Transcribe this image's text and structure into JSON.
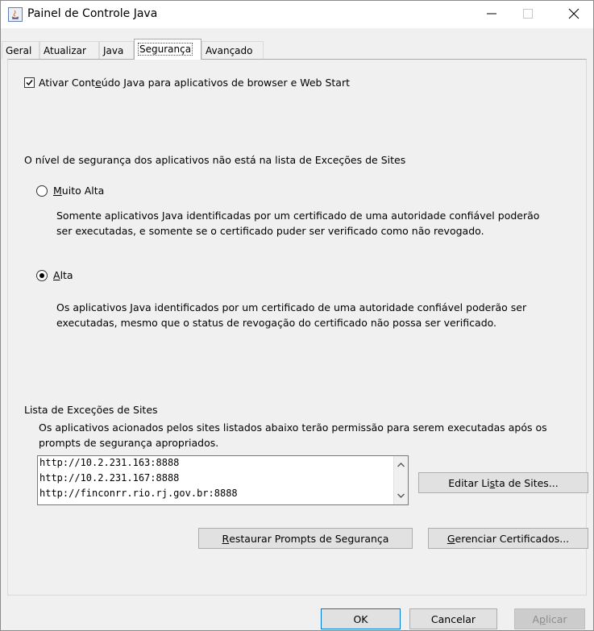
{
  "window": {
    "title": "Painel de Controle Java"
  },
  "tabs": [
    {
      "label": "Geral"
    },
    {
      "label": "Atualizar"
    },
    {
      "label": "Java"
    },
    {
      "label": "Segurança",
      "active": true
    },
    {
      "label": "Avançado"
    }
  ],
  "security": {
    "enable_java": {
      "label_pre": "Ativar Cont",
      "label_mnemonic": "e",
      "label_post": "údo Java para aplicativos de browser e Web Start",
      "checked": true
    },
    "level_heading": "O nível de segurança dos aplicativos não está na lista de Exceções de Sites",
    "levels": [
      {
        "mnemonic": "M",
        "label_rest": "uito Alta",
        "checked": false,
        "desc_line1": "Somente aplicativos Java identificadas por um certificado de uma autoridade confiável poderão",
        "desc_line2": "ser executadas, e somente se o certificado puder ser verificado como não revogado."
      },
      {
        "mnemonic": "A",
        "label_rest": "lta",
        "checked": true,
        "desc_line1": "Os aplicativos Java identificados por um certificado de uma autoridade confiável poderão ser",
        "desc_line2": "executadas, mesmo que o status de revogação do certificado não possa ser verificado."
      }
    ],
    "exceptions": {
      "heading": "Lista de Exceções de Sites",
      "desc_line1": "Os aplicativos acionados pelos sites listados abaixo terão permissão para serem executadas após os",
      "desc_line2": "prompts de segurança apropriados.",
      "sites": [
        "http://10.2.231.163:8888",
        "http://10.2.231.167:8888",
        "http://finconrr.rio.rj.gov.br:8888"
      ],
      "edit_button": {
        "pre": "Editar Li",
        "mnemonic": "s",
        "post": "ta de Sites..."
      }
    },
    "restore_button": {
      "mnemonic": "R",
      "post": "estaurar Prompts de Segurança"
    },
    "manage_button": {
      "mnemonic": "G",
      "post": "erenciar Certificados..."
    }
  },
  "footer": {
    "ok": "OK",
    "cancel": "Cancelar",
    "apply": {
      "pre": "A",
      "mnemonic": "p",
      "post": "licar"
    }
  }
}
